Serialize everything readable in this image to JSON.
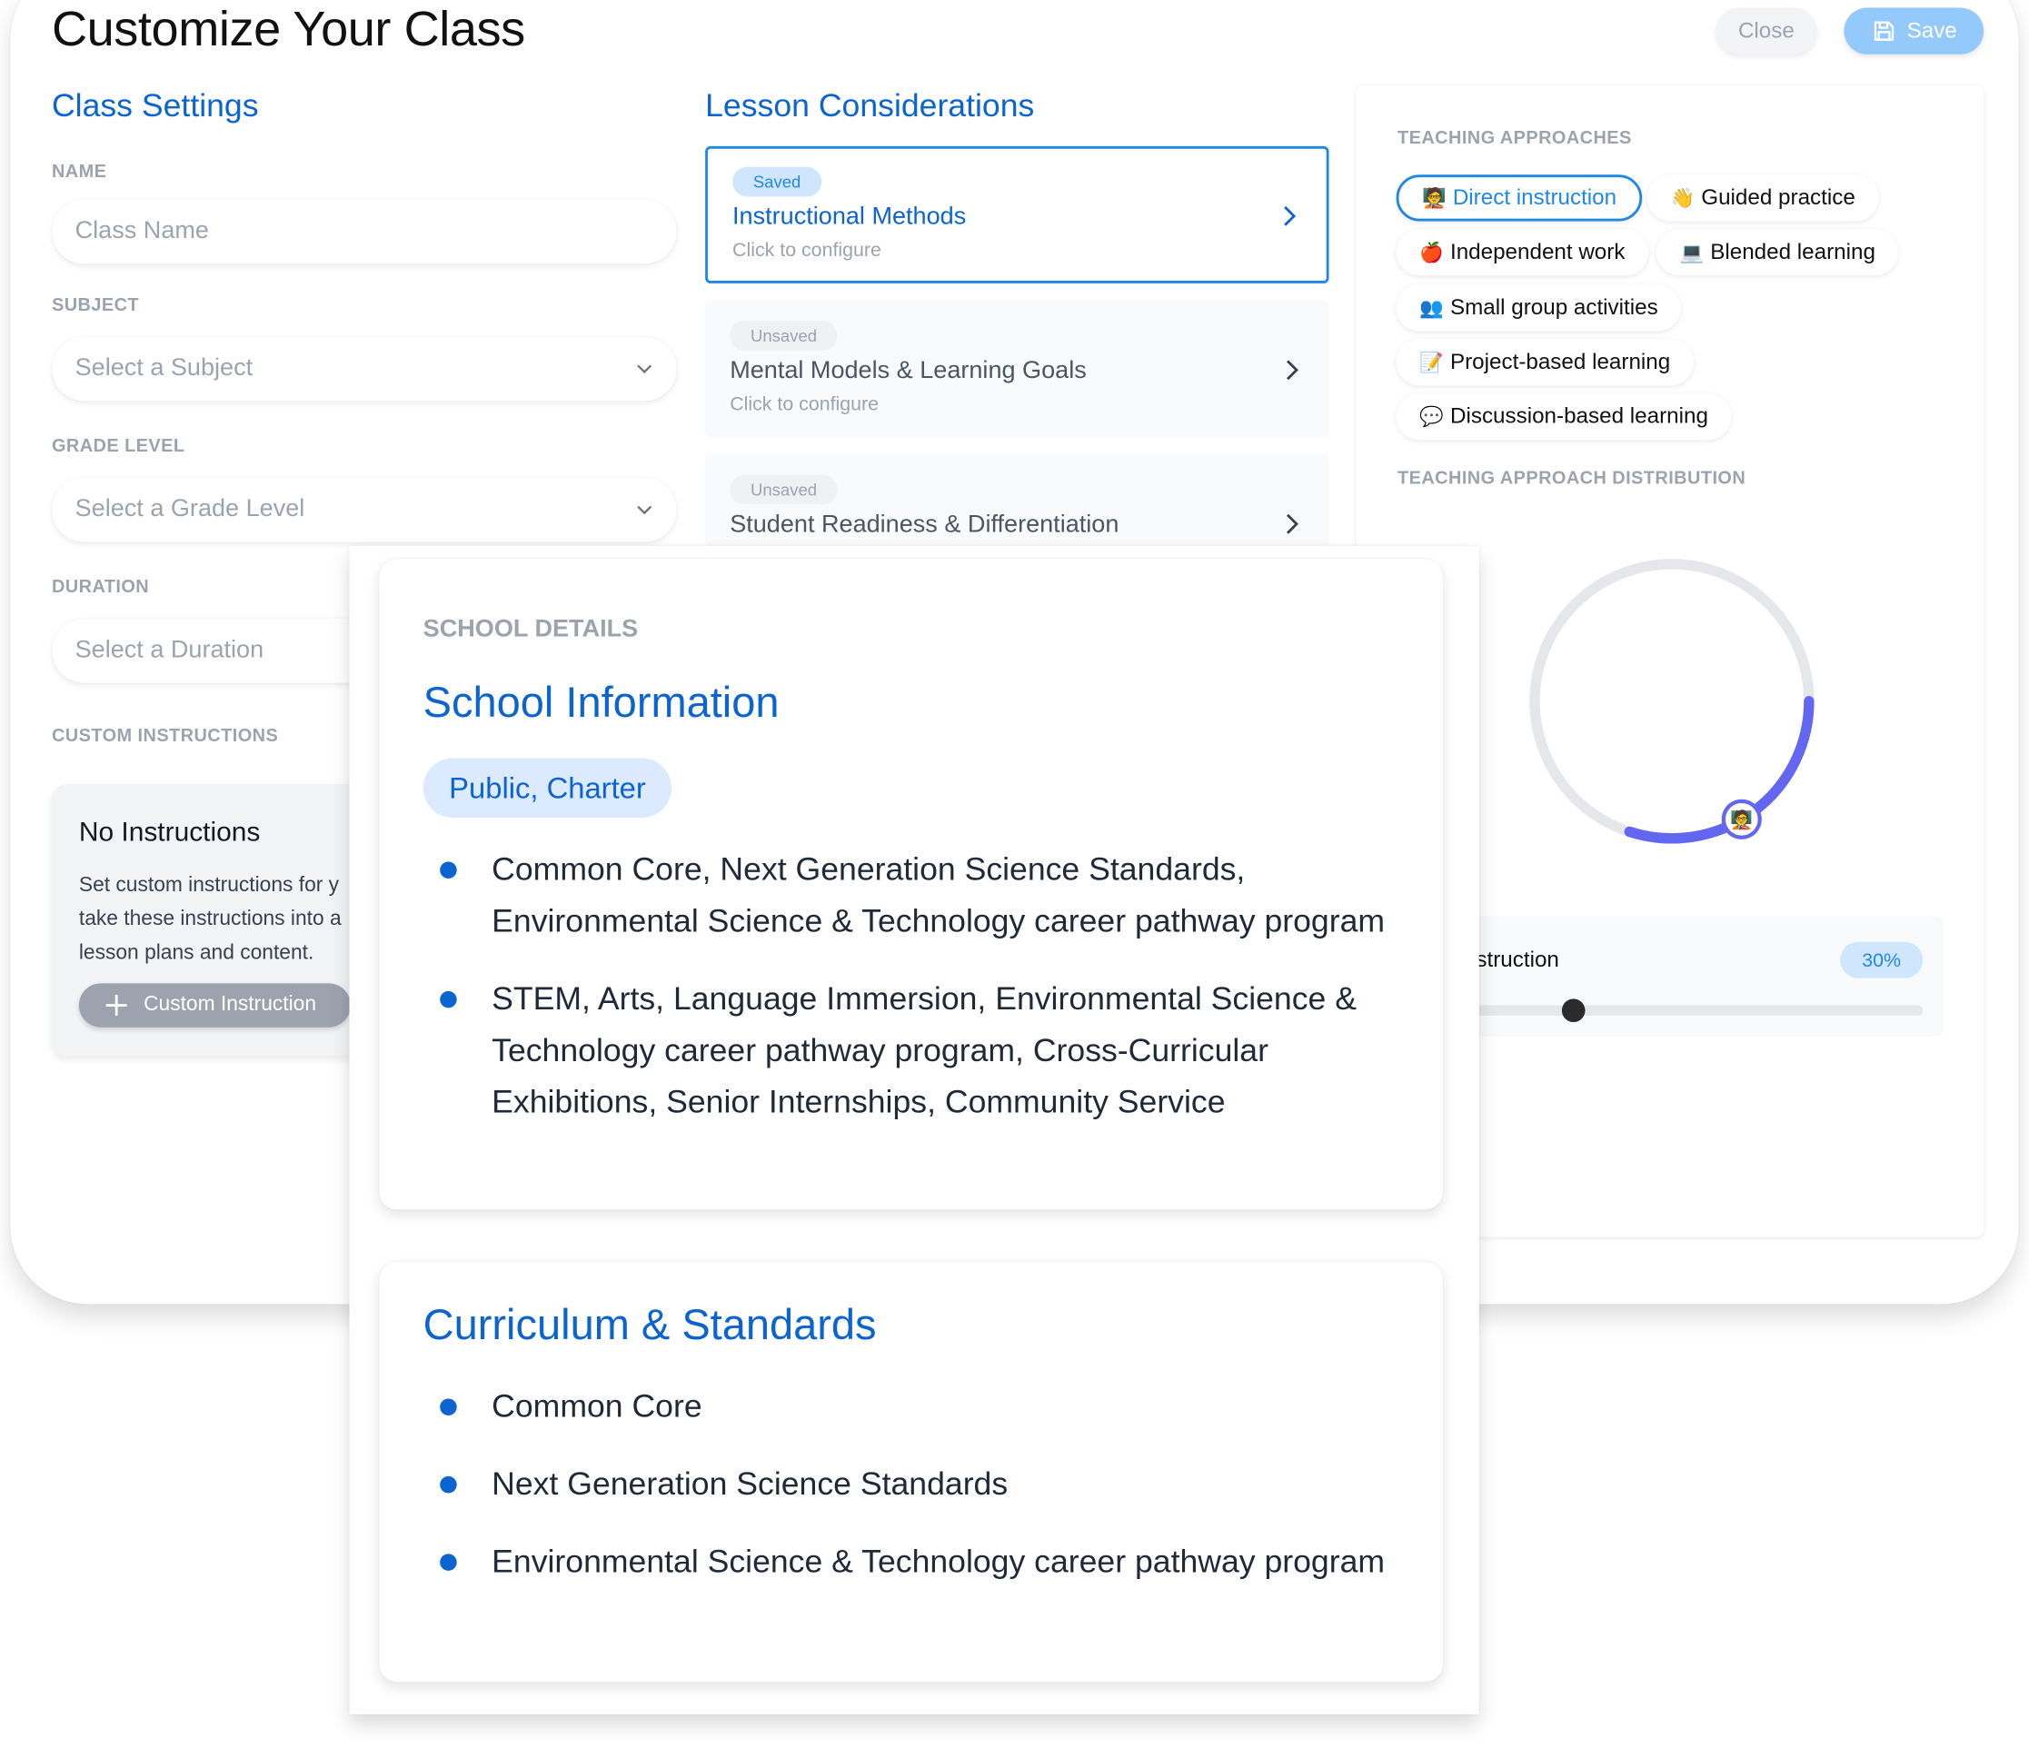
{
  "header": {
    "title": "Customize Your Class",
    "close_label": "Close",
    "save_label": "Save"
  },
  "class_settings": {
    "heading": "Class Settings",
    "name": {
      "label": "NAME",
      "value": "",
      "placeholder": "Class Name"
    },
    "subject": {
      "label": "SUBJECT",
      "placeholder": "Select a Subject"
    },
    "grade_level": {
      "label": "GRADE LEVEL",
      "placeholder": "Select a Grade Level"
    },
    "duration": {
      "label": "DURATION",
      "placeholder": "Select a Duration"
    },
    "custom_instructions": {
      "label": "CUSTOM INSTRUCTIONS",
      "empty_title": "No Instructions",
      "empty_text_lines": [
        "Set custom instructions for y",
        "take these instructions into a",
        "lesson plans and content."
      ],
      "add_button_label": "Custom Instruction"
    }
  },
  "lesson_considerations": {
    "heading": "Lesson Considerations",
    "items": [
      {
        "status": "Saved",
        "title": "Instructional Methods",
        "subtitle": "Click to configure",
        "active": true
      },
      {
        "status": "Unsaved",
        "title": "Mental Models & Learning Goals",
        "subtitle": "Click to configure",
        "active": false
      },
      {
        "status": "Unsaved",
        "title": "Student Readiness & Differentiation",
        "subtitle": "",
        "active": false
      }
    ]
  },
  "teaching_approaches": {
    "heading": "TEACHING APPROACHES",
    "chips": [
      {
        "emoji": "🧑‍🏫",
        "label": "Direct instruction",
        "selected": true
      },
      {
        "emoji": "👋",
        "label": "Guided practice",
        "selected": false
      },
      {
        "emoji": "🍎",
        "label": "Independent work",
        "selected": false
      },
      {
        "emoji": "💻",
        "label": "Blended learning",
        "selected": false
      },
      {
        "emoji": "👥",
        "label": "Small group activities",
        "selected": false
      },
      {
        "emoji": "📝",
        "label": "Project-based learning",
        "selected": false
      },
      {
        "emoji": "💬",
        "label": "Discussion-based learning",
        "selected": false
      }
    ],
    "distribution_heading": "TEACHING APPROACH DISTRIBUTION",
    "distribution": {
      "approach_emoji": "🧑‍🏫",
      "share_percent": 30,
      "ring_color": "#6366f1",
      "track_color": "#e5e7eb"
    },
    "slider": {
      "label_visible": "ect instruction",
      "value_label": "30%",
      "value_fraction": 0.3
    }
  },
  "school_details": {
    "eyebrow": "SCHOOL DETAILS",
    "title": "School Information",
    "school_type": "Public, Charter",
    "bullets": [
      "Common Core, Next Generation Science Standards, Environmental Science & Technology career pathway program",
      "STEM, Arts, Language Immersion, Environmental Science & Technology career pathway program, Cross-Curricular Exhibitions, Senior Internships, Community Service"
    ]
  },
  "curriculum": {
    "title": "Curriculum & Standards",
    "bullets": [
      "Common Core",
      "Next Generation Science Standards",
      "Environmental Science & Technology career pathway program"
    ]
  },
  "colors": {
    "accent_blue": "#0b64d0",
    "selected_blue": "#1e88e5",
    "save_button": "#93c9fb",
    "ring": "#6366f1"
  }
}
